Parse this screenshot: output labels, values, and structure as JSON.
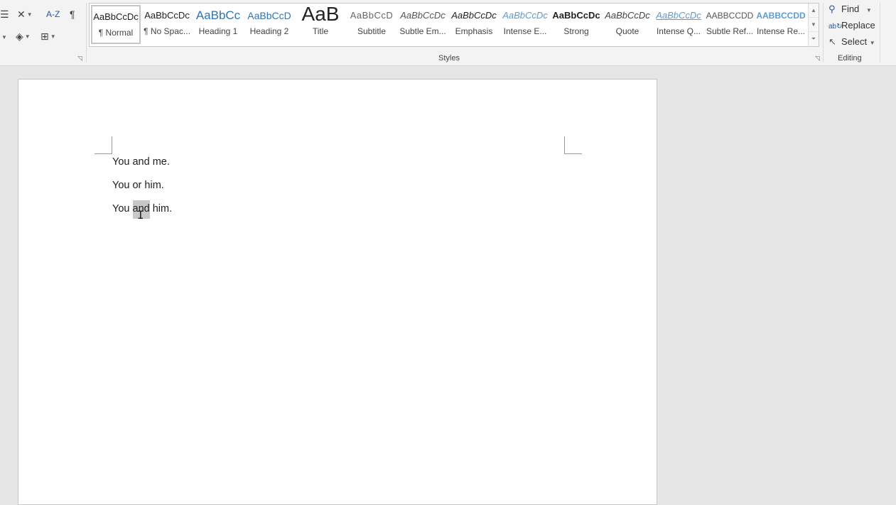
{
  "ribbon": {
    "font_group": {
      "launcher_icon": "dialog-launcher-icon"
    },
    "paragraph": {
      "sort_icon": "A-Z",
      "show_marks_icon": "¶"
    },
    "styles": {
      "group_label": "Styles",
      "items": [
        {
          "preview": "AaBbCcDc",
          "name": "¶ Normal"
        },
        {
          "preview": "AaBbCcDc",
          "name": "¶ No Spac..."
        },
        {
          "preview": "AaBbCc",
          "name": "Heading 1"
        },
        {
          "preview": "AaBbCcD",
          "name": "Heading 2"
        },
        {
          "preview": "AaB",
          "name": "Title"
        },
        {
          "preview": "AaBbCcD",
          "name": "Subtitle"
        },
        {
          "preview": "AaBbCcDc",
          "name": "Subtle Em..."
        },
        {
          "preview": "AaBbCcDc",
          "name": "Emphasis"
        },
        {
          "preview": "AaBbCcDc",
          "name": "Intense E..."
        },
        {
          "preview": "AaBbCcDc",
          "name": "Strong"
        },
        {
          "preview": "AaBbCcDc",
          "name": "Quote"
        },
        {
          "preview": "AaBbCcDc",
          "name": "Intense Q..."
        },
        {
          "preview": "AABBCCDD",
          "name": "Subtle Ref..."
        },
        {
          "preview": "AABBCCDD",
          "name": "Intense Re..."
        }
      ]
    },
    "editing": {
      "group_label": "Editing",
      "find": "Find",
      "replace": "Replace",
      "select": "Select"
    }
  },
  "document": {
    "paragraphs": [
      {
        "text": "You and me."
      },
      {
        "text": "You or him."
      },
      {
        "before": "You ",
        "selected": "and",
        "after": " him."
      }
    ]
  },
  "colors": {
    "heading_blue": "#2e74b5",
    "accent_blue": "#5b9bd5",
    "ribbon_bg": "#f3f3f3",
    "canvas_bg": "#e6e6e6"
  }
}
